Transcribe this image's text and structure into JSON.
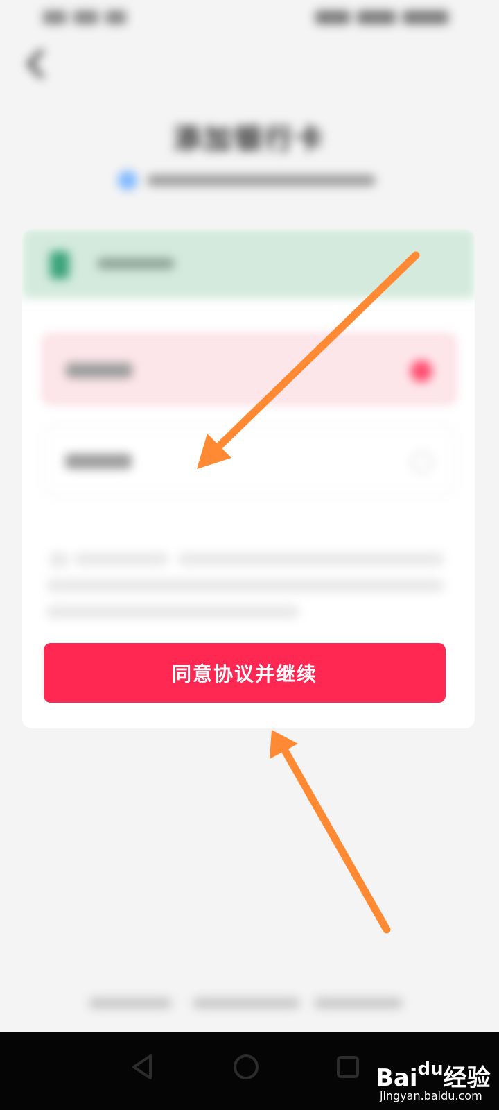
{
  "header": {
    "title": "添加银行卡"
  },
  "actions": {
    "primary_label": "同意协议并继续"
  },
  "watermark": {
    "brand": "Bai",
    "paw": "du",
    "suffix": "经验",
    "domain": "jingyan.baidu.com"
  },
  "icons": {
    "back": "chevron-left-icon",
    "shield": "shield-icon",
    "bank": "bank-card-icon",
    "nav_back": "triangle-back-icon",
    "nav_home": "circle-home-icon",
    "nav_recent": "square-recent-icon"
  },
  "colors": {
    "primary": "#ff2853",
    "selected_radio": "#ff4d70",
    "arrow": "#ff8a33",
    "card_header": "#d3eadc"
  }
}
